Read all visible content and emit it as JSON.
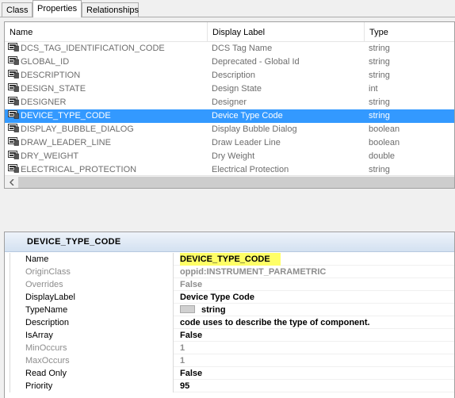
{
  "tabs": [
    {
      "label": "Class",
      "active": false
    },
    {
      "label": "Properties",
      "active": true
    },
    {
      "label": "Relationships",
      "active": false
    }
  ],
  "listview": {
    "columns": {
      "name": "Name",
      "label": "Display Label",
      "type": "Type"
    },
    "rows": [
      {
        "name": "DCS_TAG_IDENTIFICATION_CODE",
        "label": "DCS Tag Name",
        "type": "string",
        "selected": false
      },
      {
        "name": "GLOBAL_ID",
        "label": "Deprecated - Global Id",
        "type": "string",
        "selected": false
      },
      {
        "name": "DESCRIPTION",
        "label": "Description",
        "type": "string",
        "selected": false
      },
      {
        "name": "DESIGN_STATE",
        "label": "Design State",
        "type": "int",
        "selected": false
      },
      {
        "name": "DESIGNER",
        "label": "Designer",
        "type": "string",
        "selected": false
      },
      {
        "name": "DEVICE_TYPE_CODE",
        "label": "Device Type Code",
        "type": "string",
        "selected": true
      },
      {
        "name": "DISPLAY_BUBBLE_DIALOG",
        "label": "Display Bubble Dialog",
        "type": "boolean",
        "selected": false
      },
      {
        "name": "DRAW_LEADER_LINE",
        "label": "Draw Leader Line",
        "type": "boolean",
        "selected": false
      },
      {
        "name": "DRY_WEIGHT",
        "label": "Dry Weight",
        "type": "double",
        "selected": false
      },
      {
        "name": "ELECTRICAL_PROTECTION",
        "label": "Electrical Protection",
        "type": "string",
        "selected": false
      }
    ]
  },
  "details": {
    "title": "DEVICE_TYPE_CODE",
    "properties": [
      {
        "name": "Name",
        "value": "DEVICE_TYPE_CODE",
        "dim": false,
        "highlight": true
      },
      {
        "name": "OriginClass",
        "value": "oppid:INSTRUMENT_PARAMETRIC",
        "dim": true
      },
      {
        "name": "Overrides",
        "value": "False",
        "dim": true
      },
      {
        "name": "DisplayLabel",
        "value": "Device Type Code",
        "dim": false
      },
      {
        "name": "TypeName",
        "value": "string",
        "dim": false,
        "chip": true
      },
      {
        "name": "Description",
        "value": "code uses to describe the type of component.",
        "dim": false
      },
      {
        "name": "IsArray",
        "value": "False",
        "dim": false
      },
      {
        "name": "MinOccurs",
        "value": "1",
        "dim": true
      },
      {
        "name": "MaxOccurs",
        "value": "1",
        "dim": true
      },
      {
        "name": "Read Only",
        "value": "False",
        "dim": false
      },
      {
        "name": "Priority",
        "value": "95",
        "dim": false
      }
    ]
  },
  "colors": {
    "selection": "#3399ff",
    "highlight": "#ffff66",
    "header_gradient": "#d3e1f1"
  },
  "icons": {
    "row_icon": "property-icon",
    "scroll_left": "chevron-left-icon",
    "type_chip": "type-icon"
  }
}
